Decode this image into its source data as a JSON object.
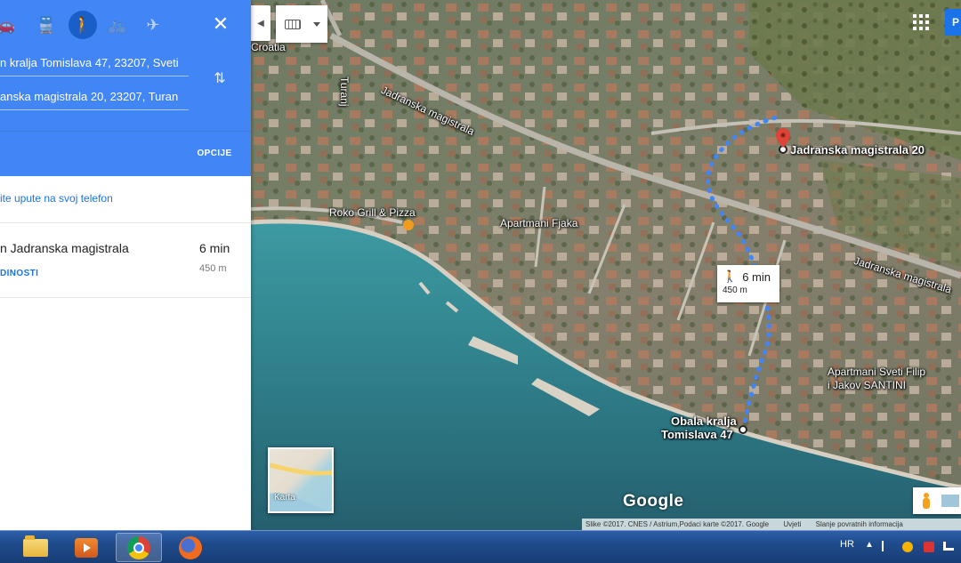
{
  "panel": {
    "modes": [
      {
        "name": "driving",
        "icon": "car-icon",
        "glyph": "🚗",
        "active": false
      },
      {
        "name": "transit",
        "icon": "bus-icon",
        "glyph": "🚆",
        "active": false
      },
      {
        "name": "walking",
        "icon": "walking-icon",
        "glyph": "🚶",
        "active": true
      },
      {
        "name": "cycling",
        "icon": "bicycle-icon",
        "glyph": "🚲",
        "active": false
      },
      {
        "name": "flight",
        "icon": "airplane-icon",
        "glyph": "✈",
        "active": false
      }
    ],
    "close_glyph": "✕",
    "origin": "n kralja Tomislava 47, 23207, Sveti",
    "destination": "anska magistrala 20, 23207, Turan",
    "swap_glyph": "⇅",
    "options_label": "OPCIJE",
    "send_to_phone": "ite upute na svoj telefon",
    "route": {
      "name": "n Jadranska magistrala",
      "time": "6 min",
      "distance": "450 m",
      "details_label": "DINOSTI"
    }
  },
  "map": {
    "labels": {
      "croatia": "Croatia",
      "turanj": "Turanj",
      "road_top": "Jadranska magistrala",
      "road_right": "Jadranska magistrala",
      "roko": "Roko Grill & Pizza",
      "fjaka": "Apartmani Fjaka",
      "dest": "Jadranska magistrala 20",
      "origin_line1": "Obala kralja",
      "origin_line2": "Tomislava 47",
      "filip_line1": "Apartmani Sveti Filip",
      "filip_line2": "i Jakov SANTINI"
    },
    "bubble": {
      "time": "6 min",
      "distance": "450 m"
    },
    "layer_label": "Karta",
    "logo": "Google",
    "signin_label": "P",
    "attribution": {
      "imagery": "Slike ©2017. CNES / Astrium,Podaci karte ©2017. Google",
      "terms": "Uvjeti",
      "feedback": "Slanje povratnih informacija"
    },
    "colors": {
      "route": "#4285f4",
      "pin": "#db4437",
      "sea": "#2f7f8a"
    }
  },
  "taskbar": {
    "language": "HR"
  }
}
